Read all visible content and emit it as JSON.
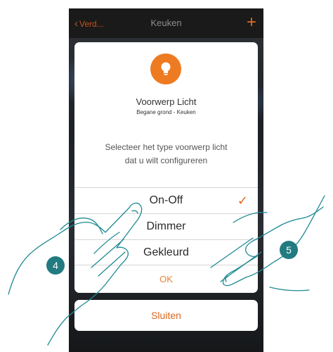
{
  "navbar": {
    "back_label": "Verd...",
    "title": "Keuken",
    "add_label": "+"
  },
  "dialog": {
    "object_title": "Voorwerp Licht",
    "object_location": "Begane grond - Keuken",
    "prompt_line1": "Selecteer het type voorwerp licht",
    "prompt_line2": "dat u wilt configureren",
    "options": [
      {
        "label": "On-Off",
        "selected": true
      },
      {
        "label": "Dimmer",
        "selected": false
      },
      {
        "label": "Gekleurd",
        "selected": false
      }
    ],
    "check_mark": "✓",
    "ok_label": "OK"
  },
  "close_label": "Sluiten",
  "steps": {
    "left": "4",
    "right": "5"
  },
  "colors": {
    "accent": "#e36a1f",
    "icon_bg": "#ee7a22",
    "step_badge": "#227b80"
  },
  "icons": {
    "object": "lightbulb-icon",
    "back": "chevron-left-icon",
    "add": "plus-icon",
    "selected": "checkmark-icon"
  }
}
